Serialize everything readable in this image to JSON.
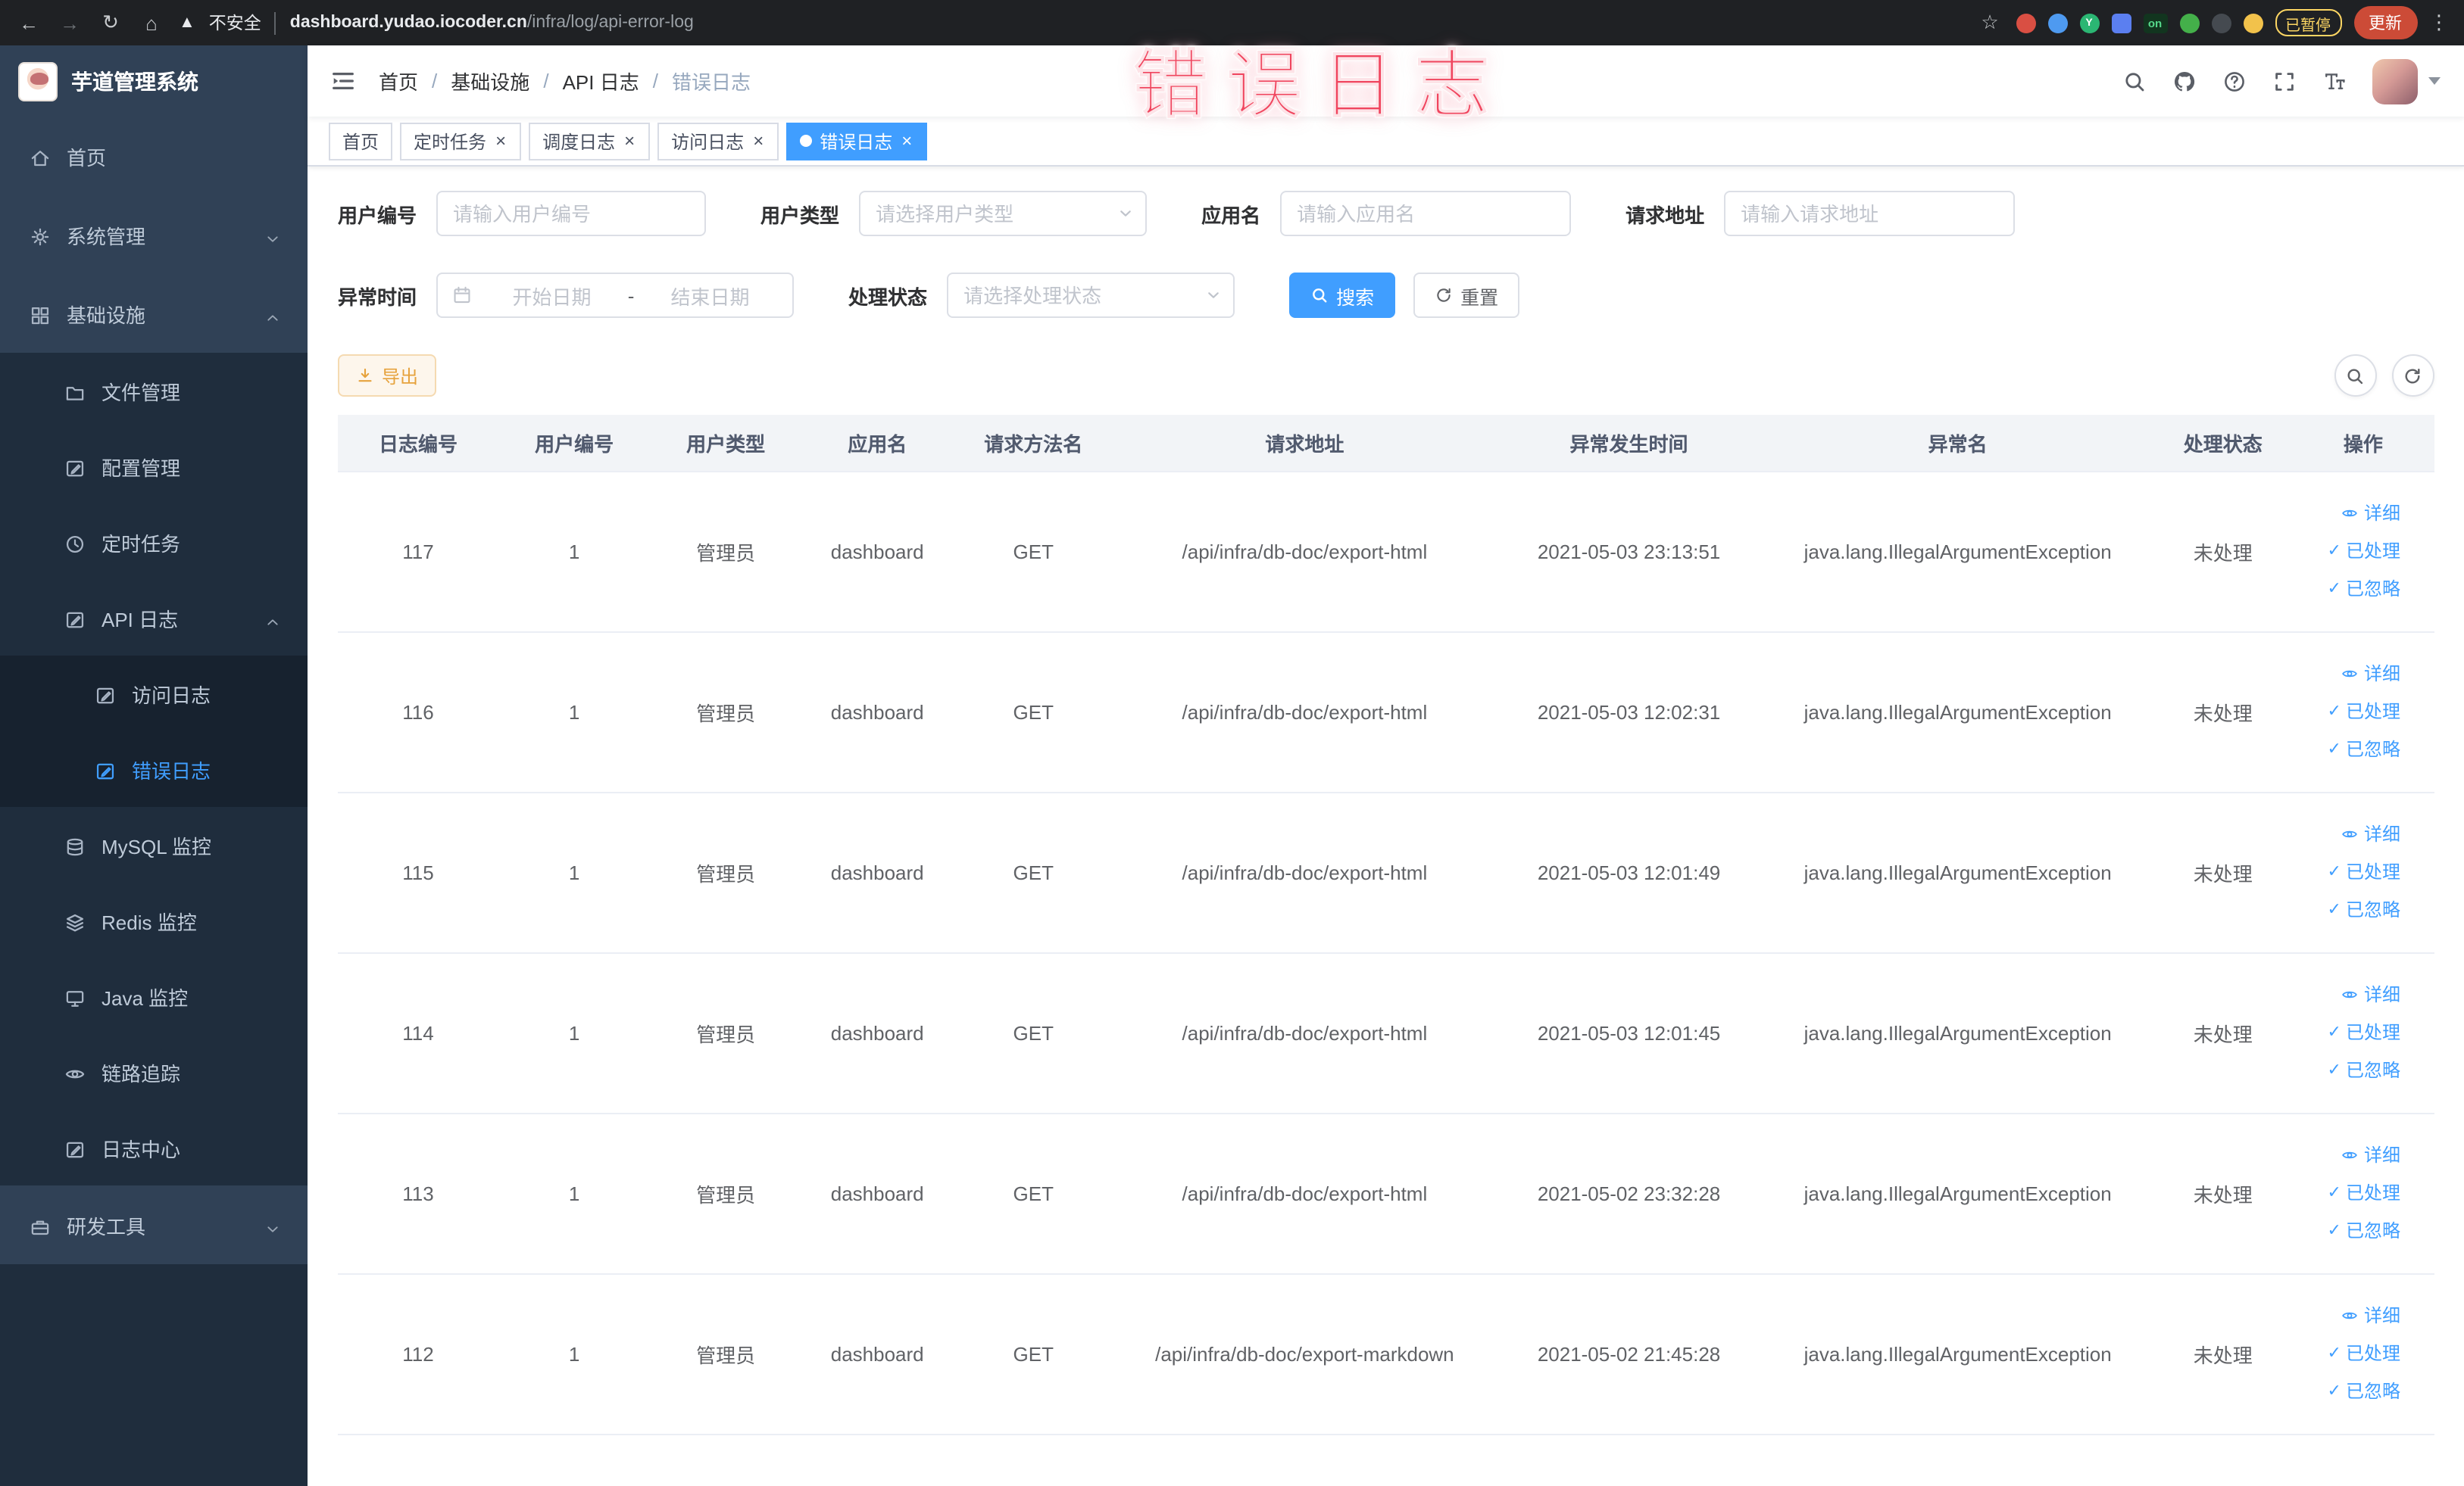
{
  "colors": {
    "accent": "#409eff",
    "warning": "#e6a23c",
    "annotation": "#f0455e",
    "sidebar_bg": "#304156",
    "sidebar_sub_bg": "#1f2d3d"
  },
  "browser": {
    "security_label": "不安全",
    "url_domain": "dashboard.yudao.iocoder.cn",
    "url_path": "/infra/log/api-error-log",
    "extension_on_badge": "on",
    "paused_badge": "已暂停",
    "update_button": "更新"
  },
  "annotation": {
    "text": "错误日志"
  },
  "sidebar": {
    "logo_title": "芋道管理系统",
    "items": [
      {
        "key": "home",
        "label": "首页",
        "icon": "home-icon",
        "level": 1
      },
      {
        "key": "system",
        "label": "系统管理",
        "icon": "gear-icon",
        "level": 1,
        "chevron": "down"
      },
      {
        "key": "infra",
        "label": "基础设施",
        "icon": "grid-icon",
        "level": 1,
        "chevron": "up"
      },
      {
        "key": "file",
        "label": "文件管理",
        "icon": "folder-icon",
        "level": 2
      },
      {
        "key": "config",
        "label": "配置管理",
        "icon": "edit-icon",
        "level": 2
      },
      {
        "key": "job",
        "label": "定时任务",
        "icon": "clock-icon",
        "level": 2
      },
      {
        "key": "api-log",
        "label": "API 日志",
        "icon": "edit-icon",
        "level": 2,
        "chevron": "up"
      },
      {
        "key": "access-log",
        "label": "访问日志",
        "icon": "edit-icon",
        "level": 3
      },
      {
        "key": "error-log",
        "label": "错误日志",
        "icon": "edit-icon",
        "level": 3,
        "active": true
      },
      {
        "key": "mysql",
        "label": "MySQL 监控",
        "icon": "db-icon",
        "level": 2
      },
      {
        "key": "redis",
        "label": "Redis 监控",
        "icon": "layers-icon",
        "level": 2
      },
      {
        "key": "java",
        "label": "Java 监控",
        "icon": "monitor-icon",
        "level": 2
      },
      {
        "key": "trace",
        "label": "链路追踪",
        "icon": "eye-icon",
        "level": 2
      },
      {
        "key": "log-center",
        "label": "日志中心",
        "icon": "edit-icon",
        "level": 2
      },
      {
        "key": "devtools",
        "label": "研发工具",
        "icon": "toolbox-icon",
        "level": 1,
        "chevron": "down"
      }
    ]
  },
  "header": {
    "breadcrumb": [
      "首页",
      "基础设施",
      "API 日志",
      "错误日志"
    ]
  },
  "tabs": [
    {
      "label": "首页",
      "closable": false,
      "active": false
    },
    {
      "label": "定时任务",
      "closable": true,
      "active": false
    },
    {
      "label": "调度日志",
      "closable": true,
      "active": false
    },
    {
      "label": "访问日志",
      "closable": true,
      "active": false
    },
    {
      "label": "错误日志",
      "closable": true,
      "active": true
    }
  ],
  "filters": {
    "user_id": {
      "label": "用户编号",
      "placeholder": "请输入用户编号"
    },
    "user_type": {
      "label": "用户类型",
      "placeholder": "请选择用户类型"
    },
    "app_name": {
      "label": "应用名",
      "placeholder": "请输入应用名"
    },
    "request_url": {
      "label": "请求地址",
      "placeholder": "请输入请求地址"
    },
    "exception_time": {
      "label": "异常时间",
      "start_placeholder": "开始日期",
      "separator": "-",
      "end_placeholder": "结束日期"
    },
    "process_status": {
      "label": "处理状态",
      "placeholder": "请选择处理状态"
    },
    "search_button": "搜索",
    "reset_button": "重置"
  },
  "toolbar": {
    "export_button": "导出"
  },
  "table": {
    "columns": [
      "日志编号",
      "用户编号",
      "用户类型",
      "应用名",
      "请求方法名",
      "请求地址",
      "异常发生时间",
      "异常名",
      "处理状态",
      "操作"
    ],
    "rows": [
      {
        "id": "117",
        "user_id": "1",
        "user_type": "管理员",
        "app": "dashboard",
        "method": "GET",
        "url": "/api/infra/db-doc/export-html",
        "time": "2021-05-03 23:13:51",
        "exception": "java.lang.IllegalArgumentException",
        "status": "未处理"
      },
      {
        "id": "116",
        "user_id": "1",
        "user_type": "管理员",
        "app": "dashboard",
        "method": "GET",
        "url": "/api/infra/db-doc/export-html",
        "time": "2021-05-03 12:02:31",
        "exception": "java.lang.IllegalArgumentException",
        "status": "未处理"
      },
      {
        "id": "115",
        "user_id": "1",
        "user_type": "管理员",
        "app": "dashboard",
        "method": "GET",
        "url": "/api/infra/db-doc/export-html",
        "time": "2021-05-03 12:01:49",
        "exception": "java.lang.IllegalArgumentException",
        "status": "未处理"
      },
      {
        "id": "114",
        "user_id": "1",
        "user_type": "管理员",
        "app": "dashboard",
        "method": "GET",
        "url": "/api/infra/db-doc/export-html",
        "time": "2021-05-03 12:01:45",
        "exception": "java.lang.IllegalArgumentException",
        "status": "未处理"
      },
      {
        "id": "113",
        "user_id": "1",
        "user_type": "管理员",
        "app": "dashboard",
        "method": "GET",
        "url": "/api/infra/db-doc/export-html",
        "time": "2021-05-02 23:32:28",
        "exception": "java.lang.IllegalArgumentException",
        "status": "未处理"
      },
      {
        "id": "112",
        "user_id": "1",
        "user_type": "管理员",
        "app": "dashboard",
        "method": "GET",
        "url": "/api/infra/db-doc/export-markdown",
        "time": "2021-05-02 21:45:28",
        "exception": "java.lang.IllegalArgumentException",
        "status": "未处理"
      }
    ],
    "actions": [
      "详细",
      "已处理",
      "已忽略"
    ]
  }
}
